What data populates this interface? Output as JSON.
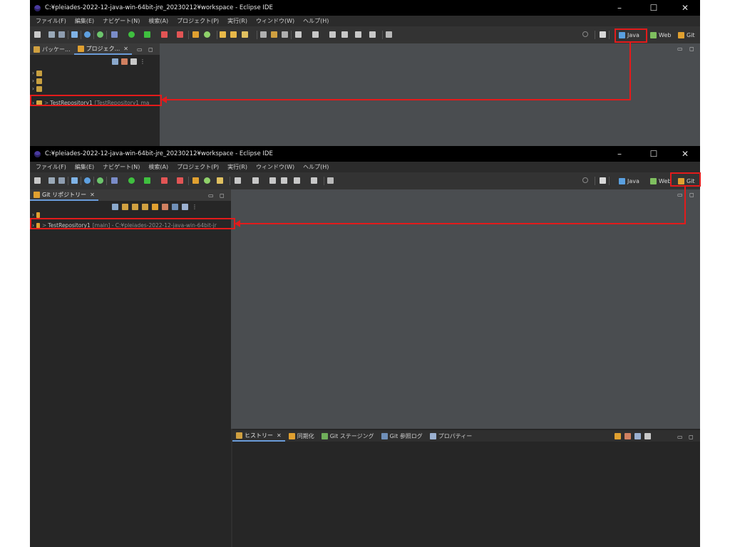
{
  "window1": {
    "title": "C:¥pleiades-2022-12-java-win-64bit-jre_20230212¥workspace - Eclipse IDE",
    "menu": [
      "ファイル(F)",
      "編集(E)",
      "ナビゲート(N)",
      "検索(A)",
      "プロジェクト(P)",
      "実行(R)",
      "ウィンドウ(W)",
      "ヘルプ(H)"
    ],
    "perspectives": [
      "Java",
      "Web",
      "Git"
    ],
    "tabs": [
      {
        "label": "パッケー..."
      },
      {
        "label": "プロジェク..."
      }
    ],
    "tree_row": {
      "name": "TestRepository1",
      "detail": "[TestRepository1 ma"
    }
  },
  "window2": {
    "title": "C:¥pleiades-2022-12-java-win-64bit-jre_20230212¥workspace - Eclipse IDE",
    "menu": [
      "ファイル(F)",
      "編集(E)",
      "ナビゲート(N)",
      "検索(A)",
      "プロジェクト(P)",
      "実行(R)",
      "ウィンドウ(W)",
      "ヘルプ(H)"
    ],
    "perspectives": [
      "Java",
      "Web",
      "Git"
    ],
    "view_tab": "Git リポジトリー",
    "tree_row": {
      "name": "TestRepository1",
      "detail": "[main] - C:¥pleiades-2022-12-java-win-64bit-jr"
    },
    "bottom_tabs": [
      "ヒストリー",
      "同期化",
      "Git ステージング",
      "Git 参照ログ",
      "プロパティー"
    ]
  },
  "window_controls": {
    "minimize": "–",
    "maximize": "☐",
    "close": "✕"
  },
  "close_glyph": "✕",
  "colors": {
    "highlight": "#e31b1b",
    "background": "#2f2f2f",
    "editor": "#4a4d50"
  }
}
